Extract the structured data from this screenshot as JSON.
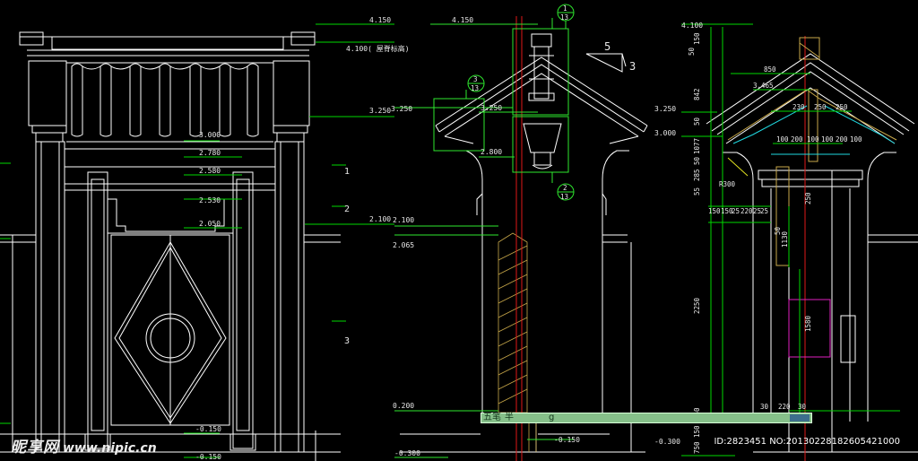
{
  "drawing": {
    "left_elevation": {
      "elevations": [
        "4.150",
        "4.100( 屋脊标高)",
        "3.250",
        "3.000",
        "2.780",
        "2.580",
        "2.530",
        "2.100",
        "2.050",
        "-0.150",
        "-0.150"
      ],
      "axis_markers": [
        "1",
        "2",
        "3"
      ]
    },
    "middle_section": {
      "elevations": [
        "4.150",
        "3.250",
        "3.250",
        "2.800",
        "2.100",
        "2.065",
        "0.200",
        "-0.300",
        "-0.150"
      ],
      "detail_callouts": [
        {
          "num": "1",
          "sheet": "13"
        },
        {
          "num": "3",
          "sheet": "13"
        },
        {
          "num": "2",
          "sheet": "13"
        }
      ],
      "slope_mark": {
        "rise": "5",
        "run": "3"
      }
    },
    "right_section": {
      "elevations": [
        "4.100",
        "3.250",
        "3.000",
        "-0.300"
      ],
      "dimensions": [
        "150",
        "50",
        "842",
        "50",
        "1077",
        "50",
        "285",
        "55",
        "2250",
        "850",
        "3.465",
        "230",
        "250",
        "250",
        "100",
        "200",
        "100",
        "100",
        "200",
        "100",
        "R300",
        "150",
        "150",
        "25",
        "220",
        "25",
        "25",
        "250",
        "1130",
        "50",
        "1580",
        "30",
        "220",
        "30",
        "150",
        "250",
        "750"
      ]
    }
  },
  "ime_bar": {
    "mode": "五笔",
    "width": "半",
    "input": "g"
  },
  "watermark": {
    "logo": "昵享网",
    "url": "www.nipic.cn",
    "id_text": "ID:2823451 NO:20130228182605421000"
  },
  "colors": {
    "background": "#000000",
    "linework": "#ffffff",
    "dimension": "#00d800",
    "callout": "#2ee82e",
    "section_axis": "#e01818",
    "hatch": "#c8a84a",
    "ime_bar": "#86c08a",
    "magenta": "#e020c0",
    "cyan": "#20d8e0"
  }
}
